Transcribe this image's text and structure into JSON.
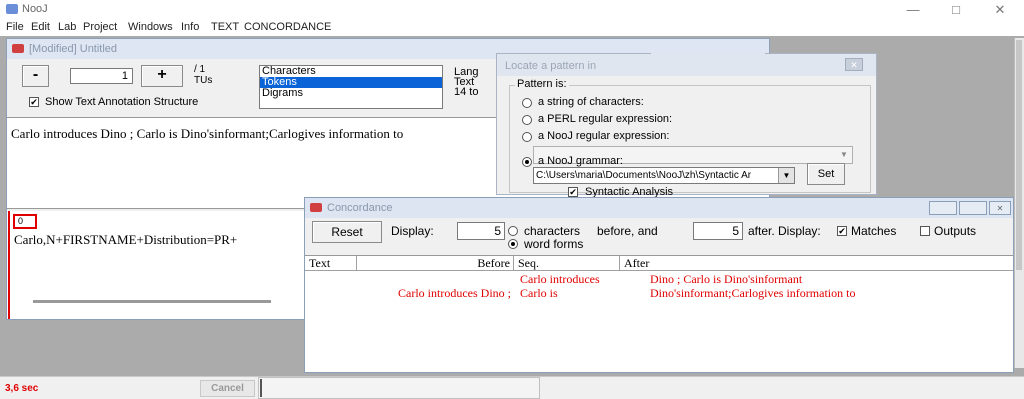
{
  "app": {
    "title": "NooJ"
  },
  "menu": [
    "File",
    "Edit",
    "Lab",
    "Project",
    "Windows",
    "Info",
    "TEXT",
    "CONCORDANCE"
  ],
  "text_window": {
    "title": "[Modified] Untitled",
    "minus_label": "-",
    "plus_label": "+",
    "unit_value": "1",
    "unit_total": "/ 1",
    "unit_label": "TUs",
    "list_items": [
      "Characters",
      "Tokens",
      "Digrams"
    ],
    "selected_item": "Tokens",
    "stats_lines": [
      "Lang",
      "Text",
      "14 to"
    ],
    "show_annotation_label": "Show Text Annotation Structure",
    "show_annotation_checked": true,
    "text_content": "Carlo introduces Dino ; Carlo is Dino'sinformant;Carlogives information to",
    "annotation_marker": "0",
    "annotation_text": "Carlo,N+FIRSTNAME+Distribution=PR+"
  },
  "locate_window": {
    "title": "Locate a pattern in",
    "group_label": "Pattern is:",
    "options": [
      "a string of characters:",
      "a PERL regular expression:",
      "a NooJ regular expression:",
      "a NooJ grammar:"
    ],
    "selected_option": "a NooJ grammar:",
    "grammar_path": "C:\\Users\\maria\\Documents\\NooJ\\zh\\Syntactic Ar",
    "set_label": "Set",
    "syntactic_label": "Syntactic Analysis",
    "syntactic_checked": true
  },
  "concordance": {
    "title": "Concordance",
    "reset_label": "Reset",
    "display_label": "Display:",
    "before_value": "5",
    "characters_label": "characters",
    "word_forms_label": "word forms",
    "word_forms_selected": true,
    "before_and_label": "before, and",
    "after_value": "5",
    "after_display_label": "after. Display:",
    "matches_label": "Matches",
    "matches_checked": true,
    "outputs_label": "Outputs",
    "outputs_checked": false,
    "columns": [
      "Text",
      "Before",
      "Seq.",
      "After"
    ],
    "rows": [
      {
        "text": "",
        "before": "",
        "seq": "Carlo introduces",
        "after": "Dino ; Carlo is Dino'sinformant"
      },
      {
        "text": "",
        "before": "Carlo introduces Dino ;",
        "seq": "Carlo is",
        "after": "Dino'sinformant;Carlogives information to"
      }
    ],
    "row_color": "#e00000"
  },
  "status": {
    "time": "3,6 sec",
    "cancel_label": "Cancel"
  }
}
